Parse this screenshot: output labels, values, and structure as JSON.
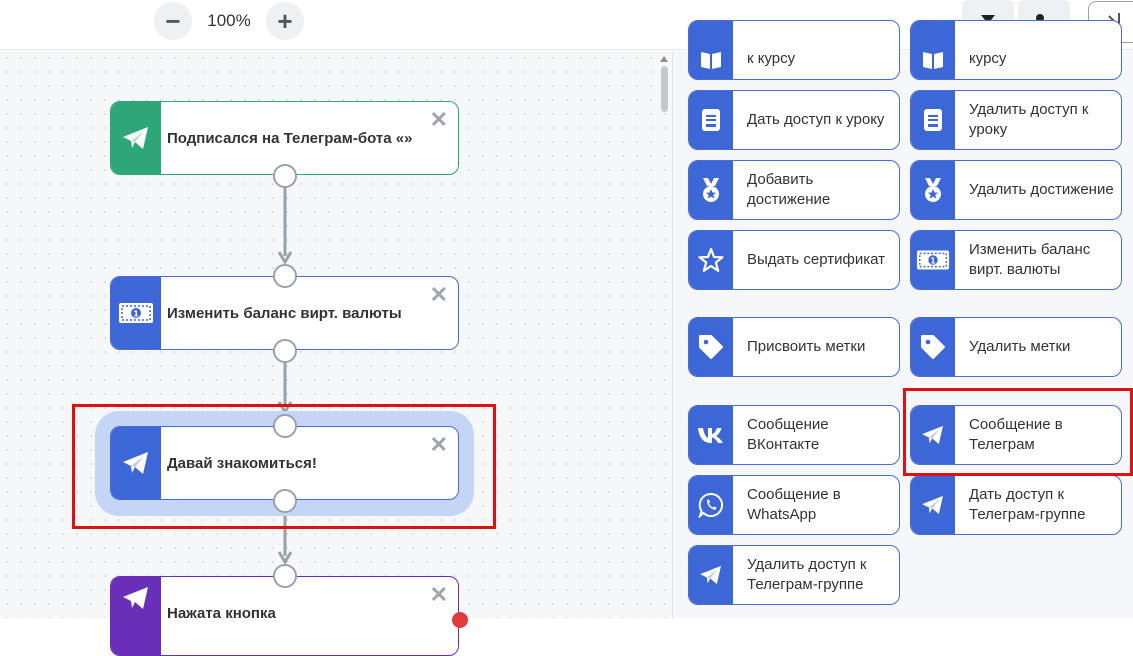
{
  "toolbar": {
    "zoom_out_symbol": "−",
    "zoom_in_symbol": "+",
    "zoom_level": "100%",
    "filter_icon": "filter-icon",
    "user_search_icon": "user-search-icon",
    "collapse_icon": "collapse-panel-icon"
  },
  "canvas": {
    "nodes": [
      {
        "title": "Подписался на Телеграм-бота «»",
        "icon": "telegram-icon",
        "color": "#2fa57a"
      },
      {
        "title": "Изменить баланс вирт. валюты",
        "icon": "banknote-icon",
        "color": "#3d66d6"
      },
      {
        "title": "Давай знакомиться!",
        "icon": "telegram-icon",
        "color": "#3d66d6"
      },
      {
        "title": "Нажата кнопка",
        "icon": "telegram-icon",
        "color": "#6a2fb8"
      }
    ],
    "close_symbol": "✕"
  },
  "panel": {
    "cards": [
      {
        "label": "к курсу",
        "icon": "book-icon"
      },
      {
        "label": "курсу",
        "icon": "book-icon"
      },
      {
        "label": "Дать доступ к уроку",
        "icon": "lesson-icon"
      },
      {
        "label": "Удалить доступ к уроку",
        "icon": "lesson-icon"
      },
      {
        "label": "Добавить достижение",
        "icon": "medal-icon"
      },
      {
        "label": "Удалить достижение",
        "icon": "medal-icon"
      },
      {
        "label": "Выдать сертификат",
        "icon": "star-icon"
      },
      {
        "label": "Изменить баланс вирт. валюты",
        "icon": "banknote-icon"
      },
      {
        "label": "Присвоить метки",
        "icon": "tag-icon"
      },
      {
        "label": "Удалить метки",
        "icon": "tag-icon"
      },
      {
        "label": "Сообщение ВКонтакте",
        "icon": "vk-icon"
      },
      {
        "label": "Сообщение в Телеграм",
        "icon": "telegram-icon"
      },
      {
        "label": "Сообщение в WhatsApp",
        "icon": "whatsapp-icon"
      },
      {
        "label": "Дать доступ к Телеграм-группе",
        "icon": "telegram-icon"
      },
      {
        "label": "Удалить доступ к Телеграм-группе",
        "icon": "telegram-icon"
      }
    ]
  },
  "colors": {
    "accent": "#3d66d6",
    "trigger_green": "#2fa57a",
    "button_purple": "#6a2fb8",
    "highlight_red": "#e01010",
    "selection_blue": "#c5d5f5"
  }
}
